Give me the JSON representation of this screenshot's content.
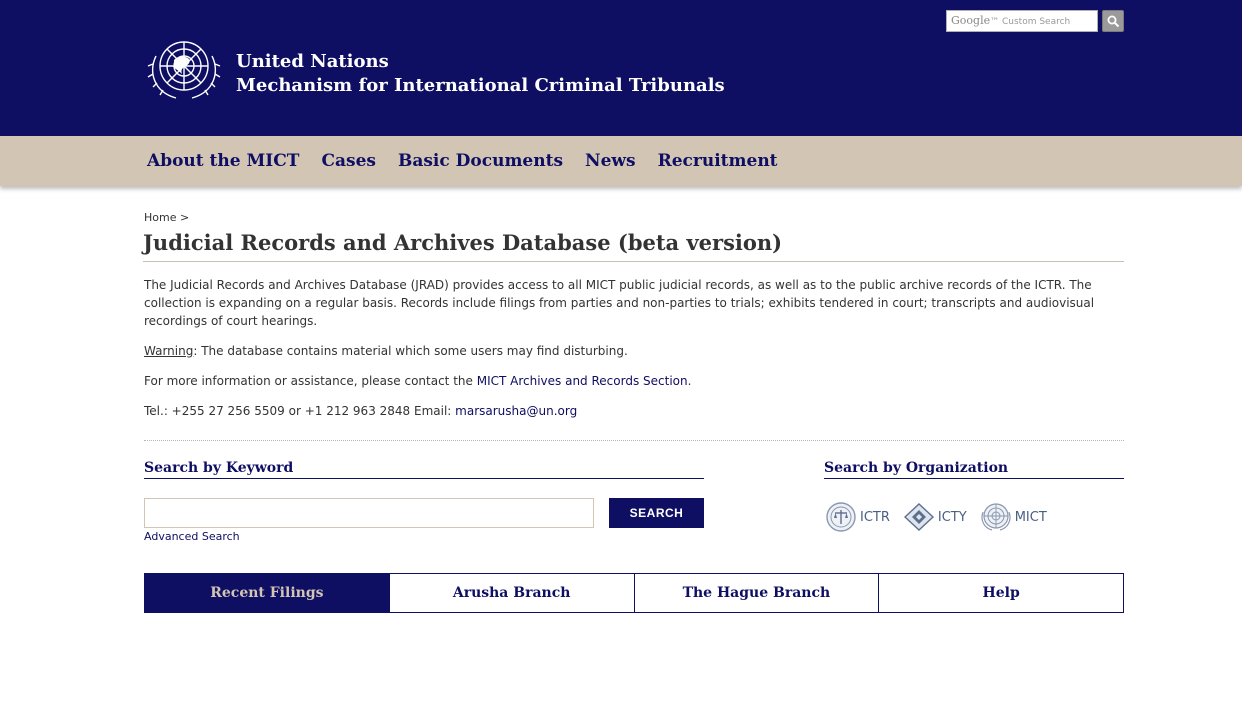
{
  "header": {
    "brand_line1": "United Nations",
    "brand_line2": "Mechanism for International Criminal Tribunals",
    "search_google": "Google",
    "search_tm": "™",
    "search_placeholder": "Custom Search"
  },
  "nav": {
    "items": [
      "About the MICT",
      "Cases",
      "Basic Documents",
      "News",
      "Recruitment"
    ]
  },
  "breadcrumb": "Home >",
  "page_title": "Judicial Records and Archives Database (beta version)",
  "intro": {
    "p1": "The Judicial Records and Archives Database (JRAD) provides access to all MICT public judicial records, as well as to the public archive records of the ICTR. The collection is expanding on a regular basis. Records include filings from parties and non-parties to trials; exhibits tendered in court; transcripts and audiovisual recordings of court hearings.",
    "warning_label": "Warning",
    "warning_text": ": The database contains material which some users may find disturbing.",
    "contact_text": "For more information or assistance, please contact the ",
    "contact_link": "MICT Archives and Records Section",
    "contact_end": ".",
    "tel_text": "Tel.: +255 27 256 5509 or +1 212 963 2848 Email: ",
    "email": "marsarusha@un.org"
  },
  "keyword_search": {
    "heading": "Search by Keyword",
    "button_label": "SEARCH",
    "input_value": "",
    "advanced_link": "Advanced Search"
  },
  "org_search": {
    "heading": "Search by Organization",
    "orgs": [
      "ICTR",
      "ICTY",
      "MICT"
    ]
  },
  "tabs": {
    "items": [
      "Recent Filings",
      "Arusha Branch",
      "The Hague Branch",
      "Help"
    ],
    "active": "Recent Filings"
  },
  "colors": {
    "navy": "#0e0e63",
    "beige": "#d3c5b4"
  }
}
